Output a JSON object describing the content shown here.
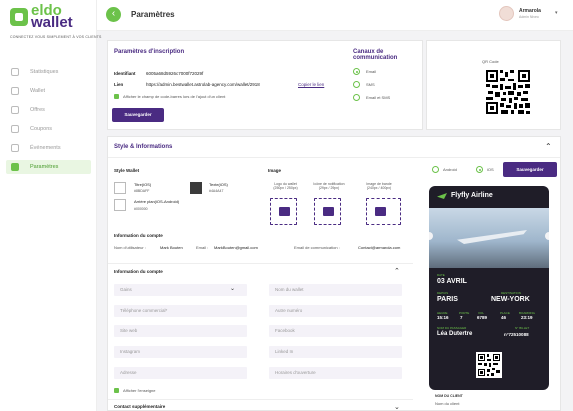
{
  "brand": {
    "eldo": "eldo",
    "wallet": "wallet",
    "tagline": "CONNECTEZ VOUS SIMPLEMENT À VOS CLIENTS"
  },
  "sidebar": {
    "items": [
      {
        "label": "Statistiques",
        "icon": "chart-icon"
      },
      {
        "label": "Wallet",
        "icon": "wallet-icon"
      },
      {
        "label": "Offres",
        "icon": "tag-icon"
      },
      {
        "label": "Coupons",
        "icon": "coupon-icon"
      },
      {
        "label": "Événements",
        "icon": "calendar-icon"
      },
      {
        "label": "Paramètres",
        "icon": "gear-icon",
        "active": true
      }
    ]
  },
  "header": {
    "title": "Paramètres",
    "user_name": "Armarola",
    "user_role": "Admin Niveo"
  },
  "inscription": {
    "title": "Paramètres d'inscription",
    "identifiant_label": "Identifiant",
    "identifiant_value": "6005a68d5926c7000f72029f",
    "lien_label": "Lien",
    "lien_value": "https://admin.bestwallet.astrolab-agency.com/wallet/2918",
    "copy_label": "Copier le lien",
    "barcode_label": "Afficher le champ de code-barres lors de l'ajout d'un client",
    "save_label": "Sauvegarder"
  },
  "channels": {
    "title": "Canaux de communication",
    "options": [
      "Email",
      "SMS",
      "Email et SMS"
    ],
    "selected": 0
  },
  "qr": {
    "label": "QR Code"
  },
  "style": {
    "title": "Style & Informations",
    "wallet_style_title": "Style Wallet",
    "colors": [
      {
        "label": "Titre(iOS)",
        "value": "#8BDAFF",
        "hex": "#ffffff"
      },
      {
        "label": "Texte(iOS)",
        "value": "#4A4A47",
        "hex": "#3b3b3b"
      },
      {
        "label": "Arrière plan(iOS-Android)",
        "value": "#000000",
        "hex": "#ffffff"
      }
    ],
    "image_title": "Image",
    "images": [
      {
        "label": "Logo du wallet\n(250px / 250px)"
      },
      {
        "label": "Icône de notification\n(29px / 29px)"
      },
      {
        "label": "Image de bande\n(240px / 400px)"
      }
    ],
    "platforms": [
      "Android",
      "iOS"
    ],
    "platform_selected": 1,
    "save_label": "Sauvegarder"
  },
  "account": {
    "title": "Information du compte",
    "username_label": "Nom d'utilisateur :",
    "username_value": "Mark Bouten",
    "email_label": "Email :",
    "email_value": "MarkBouten@gmail.com",
    "comm_email_label": "Email de communication :",
    "comm_email_value": "Contact@armarola.com"
  },
  "info_form": {
    "title": "Information du compte",
    "fields_left": [
      "Gains",
      "Téléphone commercial*",
      "Site web",
      "Instagram",
      "Adresse"
    ],
    "fields_right": [
      "Nom du wallet",
      "Autre numéro",
      "Facebook",
      "Linked In",
      "Horaires d'ouverture"
    ],
    "show_brand_label": "Afficher l'enseigne",
    "contact_title": "Contact supplémentaire"
  },
  "card_preview": {
    "brand": "Flyfly Airline",
    "date_label": "DATE",
    "date_value": "03 AVRIL",
    "from_label": "DEPUIS",
    "from_value": "PARIS",
    "to_label": "DESTINATION",
    "to_value": "NEW-YORK",
    "heure_label": "HEURE",
    "heure_value": "15:16",
    "porte_label": "PORTE",
    "porte_value": "7",
    "vol_label": "VOL",
    "vol_value": "6789",
    "siege_label": "PLACE",
    "siege_value": "46",
    "boarding_label": "BOARDING",
    "boarding_value": "23:19",
    "passenger_label": "NOM DU PASSAGER",
    "passenger_value": "Léa Dutertre",
    "ticket_label": "N° BILLET",
    "ticket_value": "n°72510088",
    "client_label": "NOM DU CLIENT",
    "client_value": "Nom du client"
  }
}
